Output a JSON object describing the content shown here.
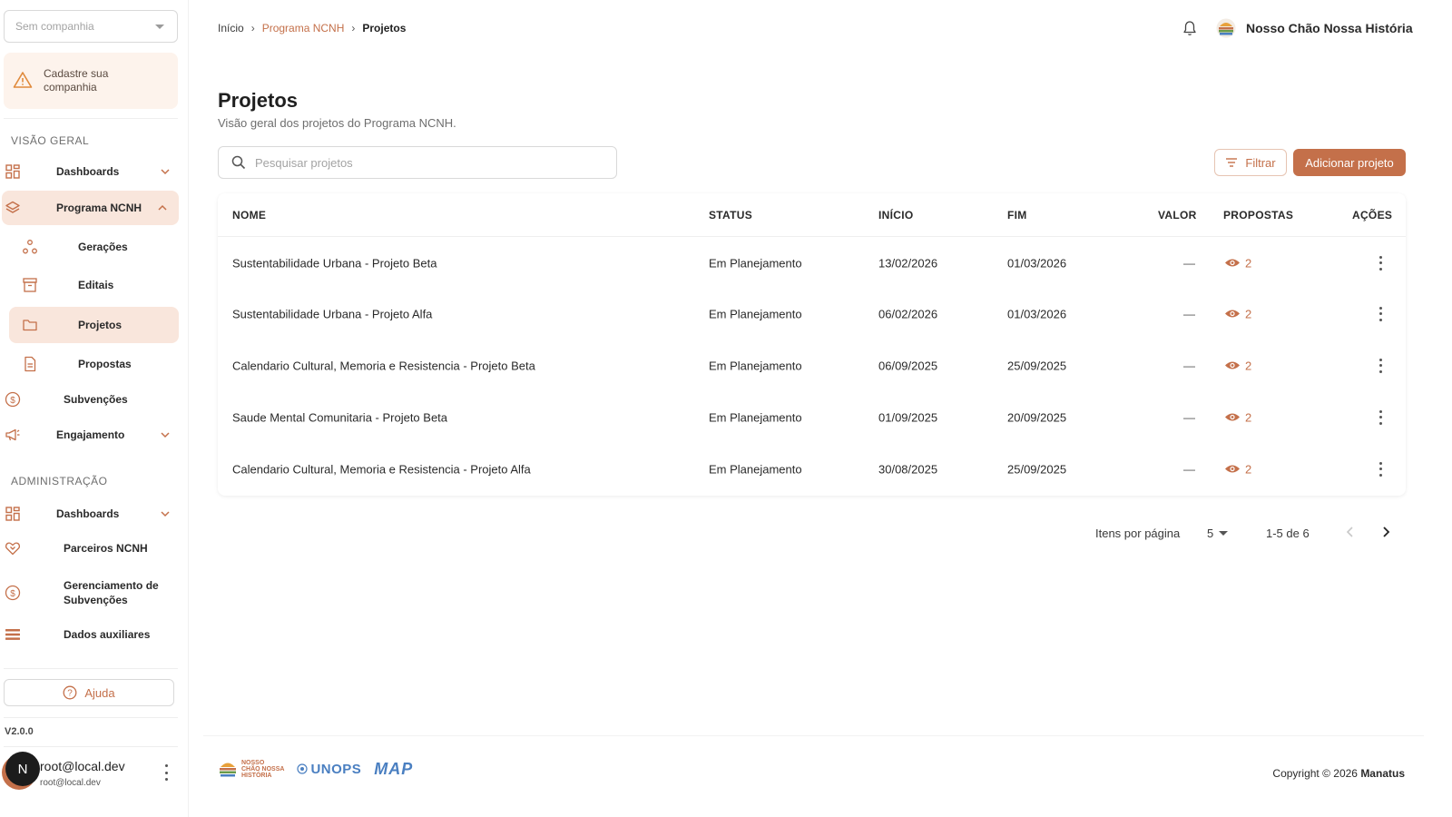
{
  "sidebar": {
    "company_placeholder": "Sem companhia",
    "warning_text": "Cadastre sua companhia",
    "sections": {
      "overview": "VISÃO GERAL",
      "admin": "ADMINISTRAÇÃO"
    },
    "items": {
      "dashboards": "Dashboards",
      "programa": "Programa NCNH",
      "geracoes": "Gerações",
      "editais": "Editais",
      "projetos": "Projetos",
      "propostas": "Propostas",
      "subvencoes": "Subvenções",
      "engajamento": "Engajamento",
      "admin_dashboards": "Dashboards",
      "parceiros": "Parceiros NCNH",
      "gerenciamento": "Gerenciamento de Subvenções",
      "dados": "Dados auxiliares"
    },
    "help_label": "Ajuda",
    "version": "V2.0.0",
    "user": {
      "initial": "N",
      "name": "root@local.dev",
      "email": "root@local.dev"
    }
  },
  "header": {
    "breadcrumb": [
      "Início",
      "Programa NCNH",
      "Projetos"
    ],
    "org_name": "Nosso Chão Nossa História"
  },
  "main": {
    "title": "Projetos",
    "subtitle": "Visão geral dos projetos do Programa NCNH.",
    "search_placeholder": "Pesquisar projetos",
    "filter_label": "Filtrar",
    "add_label": "Adicionar projeto"
  },
  "table": {
    "columns": {
      "nome": "NOME",
      "status": "STATUS",
      "inicio": "INÍCIO",
      "fim": "FIM",
      "valor": "VALOR",
      "propostas": "PROPOSTAS",
      "acoes": "AÇÕES"
    },
    "rows": [
      {
        "nome": "Sustentabilidade Urbana - Projeto Beta",
        "status": "Em Planejamento",
        "inicio": "13/02/2026",
        "fim": "01/03/2026",
        "valor": "—",
        "propostas": "2"
      },
      {
        "nome": "Sustentabilidade Urbana - Projeto Alfa",
        "status": "Em Planejamento",
        "inicio": "06/02/2026",
        "fim": "01/03/2026",
        "valor": "—",
        "propostas": "2"
      },
      {
        "nome": "Calendario Cultural, Memoria e Resistencia - Projeto Beta",
        "status": "Em Planejamento",
        "inicio": "06/09/2025",
        "fim": "25/09/2025",
        "valor": "—",
        "propostas": "2"
      },
      {
        "nome": "Saude Mental Comunitaria - Projeto Beta",
        "status": "Em Planejamento",
        "inicio": "01/09/2025",
        "fim": "20/09/2025",
        "valor": "—",
        "propostas": "2"
      },
      {
        "nome": "Calendario Cultural, Memoria e Resistencia - Projeto Alfa",
        "status": "Em Planejamento",
        "inicio": "30/08/2025",
        "fim": "25/09/2025",
        "valor": "—",
        "propostas": "2"
      }
    ]
  },
  "pagination": {
    "items_label": "Itens por página",
    "page_size": "5",
    "range": "1-5 de 6"
  },
  "footer": {
    "logo_ncnh_lines": [
      "NOSSO",
      "CHÃO NOSSA",
      "HISTÓRIA"
    ],
    "logo_unops": "UNOPS",
    "logo_map": "MAP",
    "copyright_prefix": "Copyright © 2026",
    "copyright_brand": "Manatus"
  },
  "colors": {
    "accent": "#c4704a",
    "active_bg": "#f9e6dc",
    "warning_bg": "#fdf3ec"
  }
}
